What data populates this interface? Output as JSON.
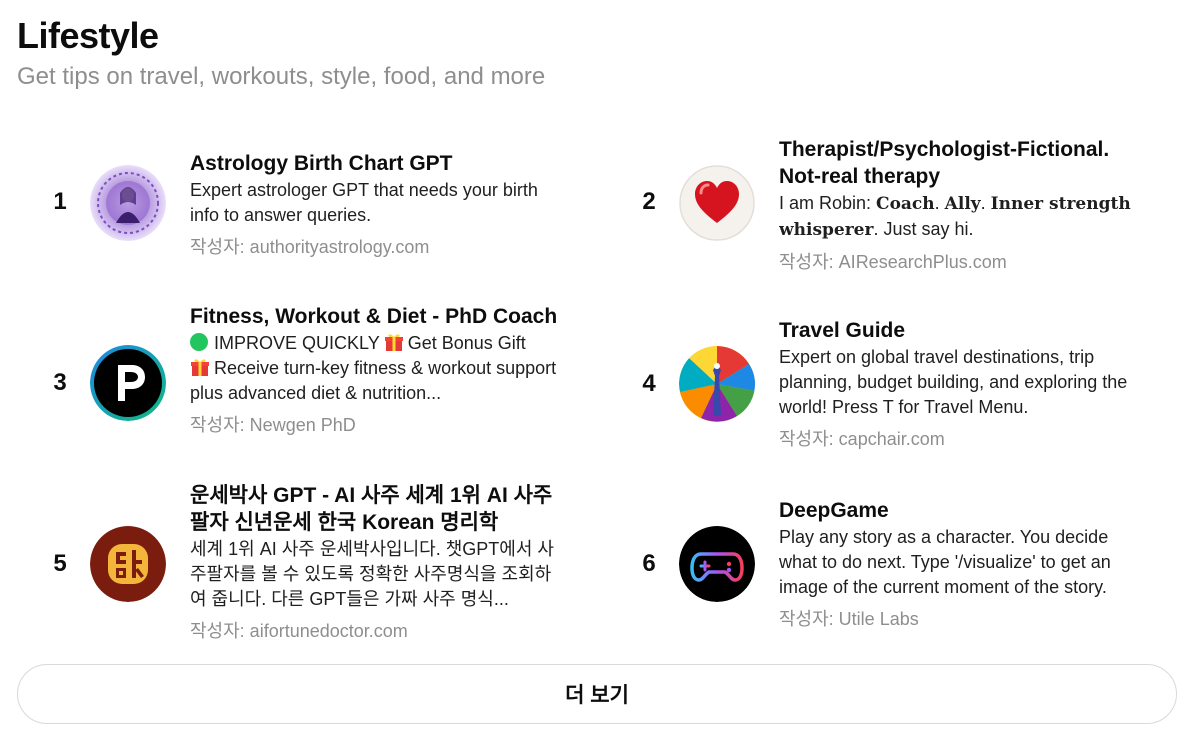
{
  "page": {
    "title": "Lifestyle",
    "subtitle": "Get tips on travel, workouts, style, food, and more"
  },
  "items": [
    {
      "rank": "1",
      "title": "Astrology Birth Chart GPT",
      "description": "Expert astrologer GPT that needs your birth info to answer queries.",
      "author": "작성자: authorityastrology.com",
      "icon": "astrology-avatar"
    },
    {
      "rank": "2",
      "title": "Therapist/Psychologist-Fictional. Not-real therapy",
      "description_parts": [
        "I am Robin: ",
        "Coach",
        ". ",
        "Ally",
        ". ",
        "Inner strength whisperer",
        ". Just say hi."
      ],
      "author": "작성자: AIResearchPlus.com",
      "icon": "heart-avatar"
    },
    {
      "rank": "3",
      "title": "Fitness, Workout & Diet - PhD Coach",
      "description_parts": [
        "IMPROVE QUICKLY",
        "Get Bonus Gift",
        "Receive turn-key fitness & workout support plus advanced diet & nutrition..."
      ],
      "author": "작성자: Newgen PhD",
      "icon": "p-logo-avatar"
    },
    {
      "rank": "4",
      "title": "Travel Guide",
      "description": "Expert on global travel destinations, trip planning, budget building, and exploring the world! Press T for Travel Menu.",
      "author": "작성자: capchair.com",
      "icon": "travel-avatar"
    },
    {
      "rank": "5",
      "title": "운세박사 GPT - AI 사주 세계 1위 AI 사주팔자 신년운세 한국 Korean 명리학",
      "description": "세계 1위 AI 사주 운세박사입니다. 챗GPT에서 사주팔자를 볼 수 있도록 정확한 사주명식을 조회하여 줍니다. 다른 GPT들은 가짜 사주 명식...",
      "author": "작성자: aifortunedoctor.com",
      "icon": "fortune-avatar"
    },
    {
      "rank": "6",
      "title": "DeepGame",
      "description": "Play any story as a character. You decide what to do next. Type '/visualize' to get an image of the current moment of the story.",
      "author": "작성자: Utile Labs",
      "icon": "gamepad-avatar"
    }
  ],
  "more_button": {
    "label": "더 보기"
  },
  "colors": {
    "muted": "#8e8e8e",
    "text": "#0d0d0d",
    "border": "#d9d9d9"
  }
}
